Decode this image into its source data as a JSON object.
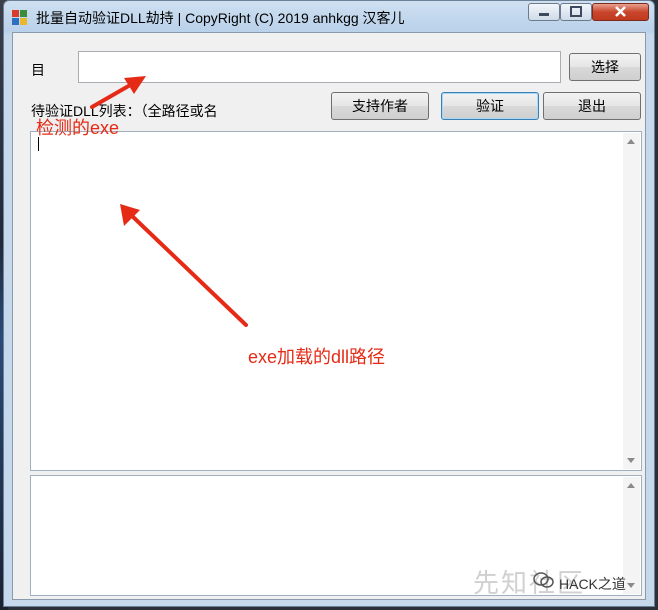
{
  "window": {
    "title": "批量自动验证DLL劫持 | CopyRight (C) 2019 anhkgg 汉客儿"
  },
  "form": {
    "target_label": "目",
    "target_value": "",
    "select_button": "选择",
    "list_label": "待验证DLL列表：（全路径或名",
    "support_button": "支持作者",
    "verify_button": "验证",
    "exit_button": "退出"
  },
  "annotations": {
    "exe_hint": "检测的exe",
    "dll_hint": "exe加载的dll路径",
    "color": "#e52b16"
  },
  "watermark": {
    "text": "先知社区",
    "brand": "HACK之道"
  }
}
